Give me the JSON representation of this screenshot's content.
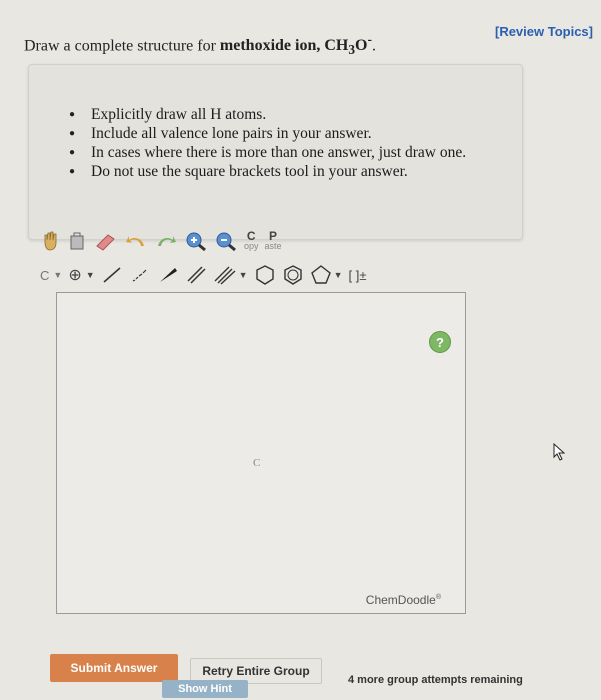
{
  "header": {
    "review_link": "[Review Topics]"
  },
  "question": {
    "prefix": "Draw a complete structure for ",
    "compound": "methoxide ion, CH",
    "subscript": "3",
    "suffix": "O",
    "superscript": "-",
    "period": "."
  },
  "instructions": [
    "Explicitly draw all H atoms.",
    "Include all valence lone pairs in your answer.",
    "In cases where there is more than one answer, just draw one.",
    "Do not use the square brackets tool in your answer."
  ],
  "editor": {
    "toolbar": {
      "copy_top": "C",
      "copy_bottom": "opy",
      "paste_top": "P",
      "paste_bottom": "aste",
      "atom_label": "C",
      "bracket_label": "[ ]±"
    },
    "canvas_atom": "C",
    "help": "?",
    "brand": "ChemDoodle",
    "brand_mark": "®"
  },
  "actions": {
    "submit": "Submit Answer",
    "retry": "Retry Entire Group",
    "hint": "Show Hint",
    "attempts": "4 more group attempts remaining"
  }
}
